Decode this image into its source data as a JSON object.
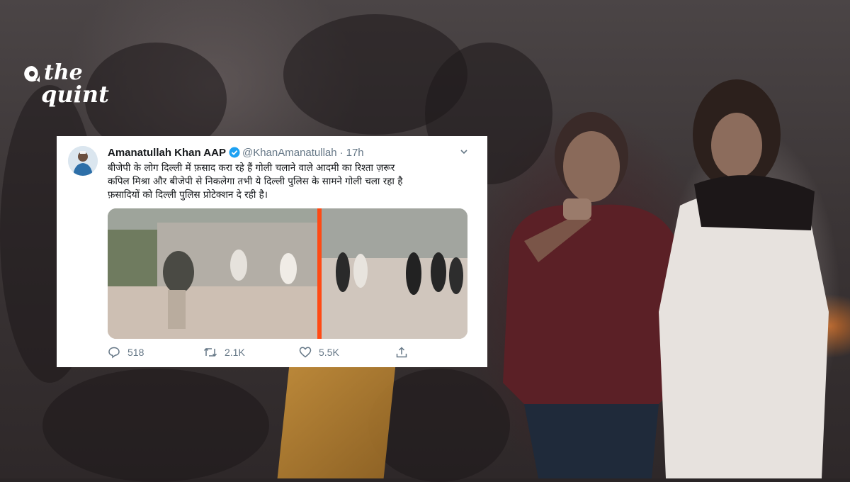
{
  "brand": {
    "logo_line1": "the",
    "logo_line2": "quint"
  },
  "tweet": {
    "name": "Amanatullah Khan AAP",
    "handle": "@KhanAmanatullah",
    "separator": "·",
    "time": "17h",
    "text_lines": [
      "बीजेपी के लोग दिल्ली में फ़साद करा रहे हैं  गोली चलाने वाले  आदमी का रिश्ता ज़रूर",
      "कपिल मिश्रा और बीजेपी से निकलेगा तभी ये दिल्ली पुलिस के सामने गोली चला रहा है",
      "फ़सादियों को दिल्ली पुलिस प्रोटेक्शन दे रही है।"
    ],
    "actions": {
      "replies": "518",
      "retweets": "2.1K",
      "likes": "5.5K"
    }
  },
  "colors": {
    "verified": "#1da1f2",
    "divider": "#ff4a14",
    "muted": "#657786"
  },
  "icons": [
    "chevron-down-icon",
    "verified-badge-icon",
    "reply-icon",
    "retweet-icon",
    "like-icon",
    "share-icon"
  ]
}
